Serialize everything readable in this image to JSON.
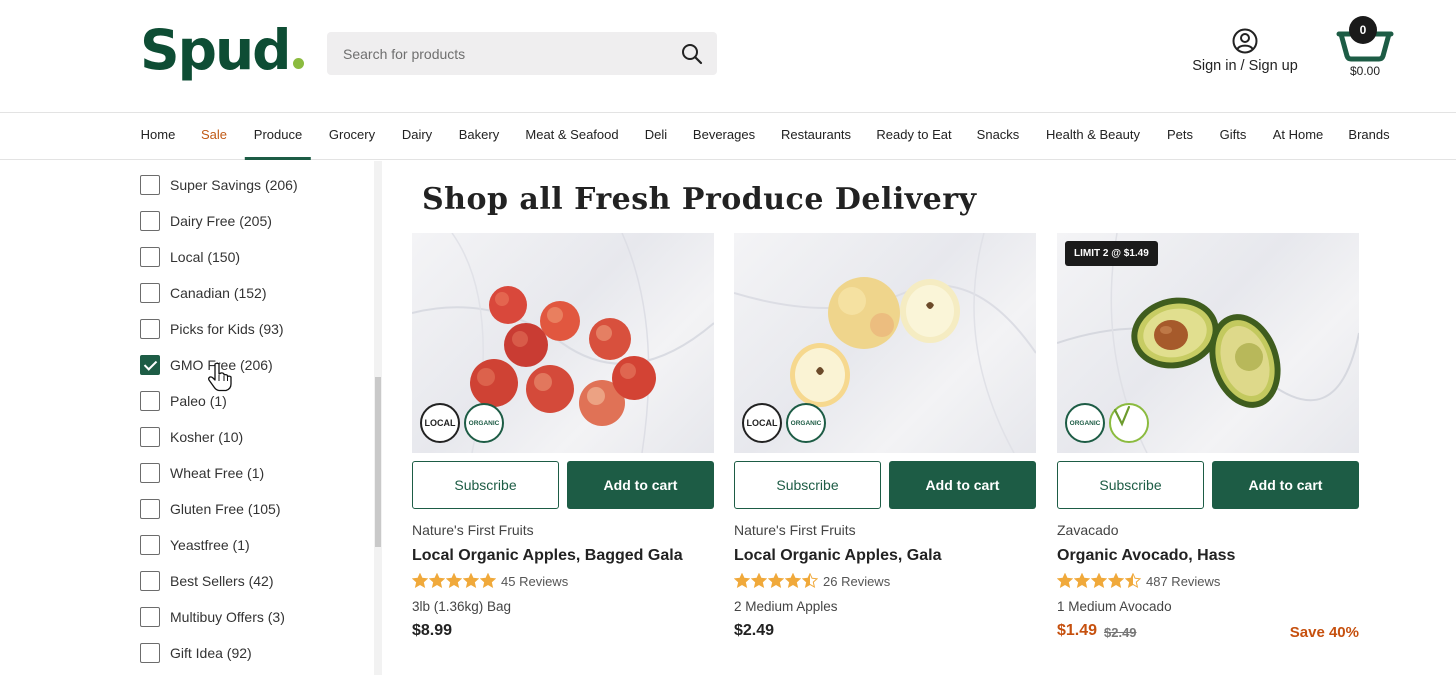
{
  "header": {
    "logo_text": "Spud",
    "search_placeholder": "Search for products",
    "signin_label": "Sign in / Sign up",
    "cart_count": "0",
    "cart_total": "$0.00",
    "brand_color": "#0e4d34",
    "accent_color": "#1d5c45",
    "sale_color": "#c6500e"
  },
  "nav": {
    "items": [
      "Home",
      "Sale",
      "Produce",
      "Grocery",
      "Dairy",
      "Bakery",
      "Meat & Seafood",
      "Deli",
      "Beverages",
      "Restaurants",
      "Ready to Eat",
      "Snacks",
      "Health & Beauty",
      "Pets",
      "Gifts",
      "At Home",
      "Brands"
    ],
    "active": "Produce"
  },
  "filters": [
    {
      "label": "Super Savings (206)",
      "checked": false
    },
    {
      "label": "Dairy Free (205)",
      "checked": false
    },
    {
      "label": "Local (150)",
      "checked": false
    },
    {
      "label": "Canadian (152)",
      "checked": false
    },
    {
      "label": "Picks for Kids (93)",
      "checked": false
    },
    {
      "label": "GMO Free (206)",
      "checked": true
    },
    {
      "label": "Paleo (1)",
      "checked": false
    },
    {
      "label": "Kosher (10)",
      "checked": false
    },
    {
      "label": "Wheat Free (1)",
      "checked": false
    },
    {
      "label": "Gluten Free (105)",
      "checked": false
    },
    {
      "label": "Yeastfree (1)",
      "checked": false
    },
    {
      "label": "Best Sellers (42)",
      "checked": false
    },
    {
      "label": "Multibuy Offers (3)",
      "checked": false
    },
    {
      "label": "Gift Idea (92)",
      "checked": false
    }
  ],
  "main": {
    "title": "Shop all Fresh Produce Delivery"
  },
  "products": [
    {
      "brand": "Nature's First Fruits",
      "name": "Local Organic Apples, Bagged Gala",
      "rating": 5,
      "reviews": "45 Reviews",
      "size": "3lb (1.36kg) Bag",
      "price": "$8.99",
      "subscribe_label": "Subscribe",
      "add_label": "Add to cart",
      "badges": [
        "LOCAL",
        "ORGANIC"
      ],
      "image": "bagged-gala-apples"
    },
    {
      "brand": "Nature's First Fruits",
      "name": "Local Organic Apples, Gala",
      "rating": 4.5,
      "reviews": "26 Reviews",
      "size": "2 Medium Apples",
      "price": "$2.49",
      "subscribe_label": "Subscribe",
      "add_label": "Add to cart",
      "badges": [
        "LOCAL",
        "ORGANIC"
      ],
      "image": "gala-apples"
    },
    {
      "brand": "Zavacado",
      "name": "Organic Avocado, Hass",
      "rating": 4.5,
      "reviews": "487 Reviews",
      "size": "1 Medium Avocado",
      "price": "$1.49",
      "was_price": "$2.49",
      "save_label": "Save 40%",
      "limit_label": "LIMIT 2 @ $1.49",
      "subscribe_label": "Subscribe",
      "add_label": "Add to cart",
      "badges": [
        "ORGANIC",
        "VEGAN"
      ],
      "image": "hass-avocado"
    }
  ]
}
